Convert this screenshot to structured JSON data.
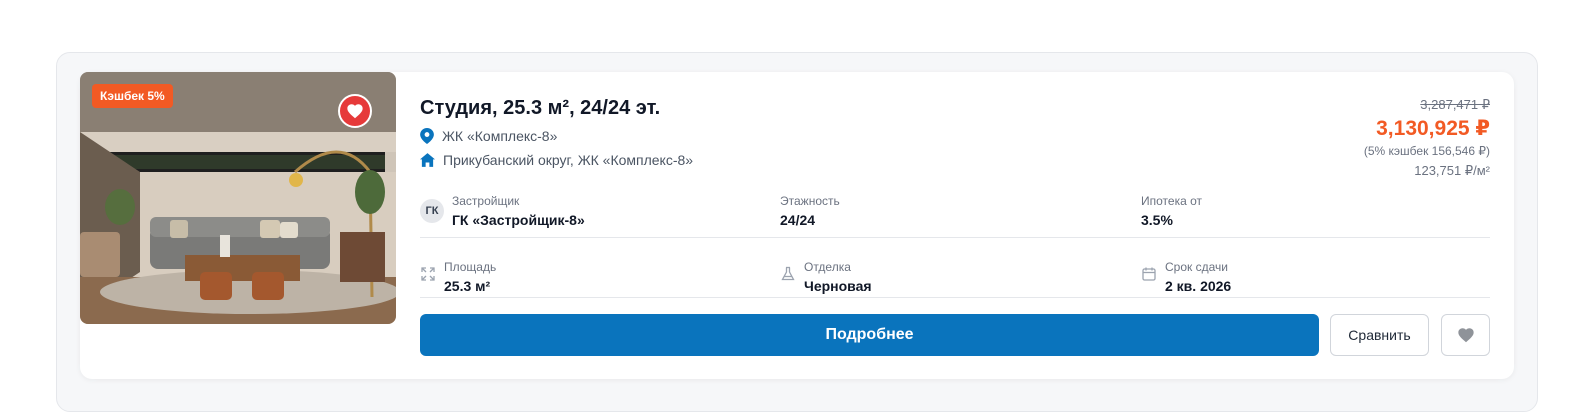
{
  "listing": {
    "cashback_badge": "Кэшбек 5%",
    "title": "Студия, 25.3 м², 24/24 эт.",
    "complex": "ЖК «Комплекс-8»",
    "address": "Прикубанский округ, ЖК «Комплекс-8»",
    "old_price": "3,287,471 ₽",
    "price": "3,130,925 ₽",
    "cashback_note": "(5% кэшбек 156,546 ₽)",
    "price_per_m2": "123,751 ₽/м²"
  },
  "details": {
    "developer_initials": "ГК",
    "developer_label": "Застройщик",
    "developer_value": "ГК «Застройщик-8»",
    "floors_label": "Этажность",
    "floors_value": "24/24",
    "mortgage_label": "Ипотека от",
    "mortgage_value": "3.5%",
    "area_label": "Площадь",
    "area_value": "25.3 м²",
    "finish_label": "Отделка",
    "finish_value": "Черновая",
    "deadline_label": "Срок сдачи",
    "deadline_value": "2 кв. 2026"
  },
  "actions": {
    "more_label": "Подробнее",
    "compare_label": "Сравнить"
  },
  "colors": {
    "accent_blue": "#0a74bd",
    "price_orange": "#f25a24",
    "fav_red": "#e63a3a"
  },
  "icons": [
    "location-pin-icon",
    "house-icon",
    "expand-icon",
    "flask-icon",
    "calendar-icon",
    "heart-icon"
  ]
}
